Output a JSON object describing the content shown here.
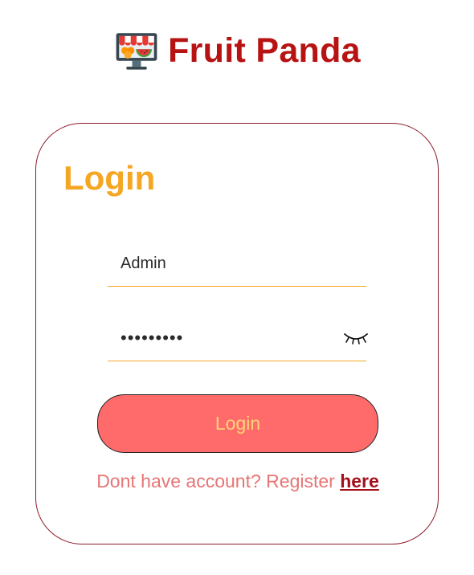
{
  "header": {
    "title": "Fruit Panda",
    "logo_icon": "fruit-shop-monitor-icon"
  },
  "login_card": {
    "title": "Login",
    "username_value": "Admin",
    "password_value": "•••••••••",
    "password_toggle_icon": "eye-closed-icon",
    "submit_label": "Login",
    "register_prompt": "Dont have account? Register",
    "register_link": "here"
  },
  "colors": {
    "brand_red": "#b81313",
    "accent_orange": "#f5a623",
    "button_red": "#ff6b6b",
    "button_text": "#ffd479",
    "prompt_text": "#e87575"
  }
}
